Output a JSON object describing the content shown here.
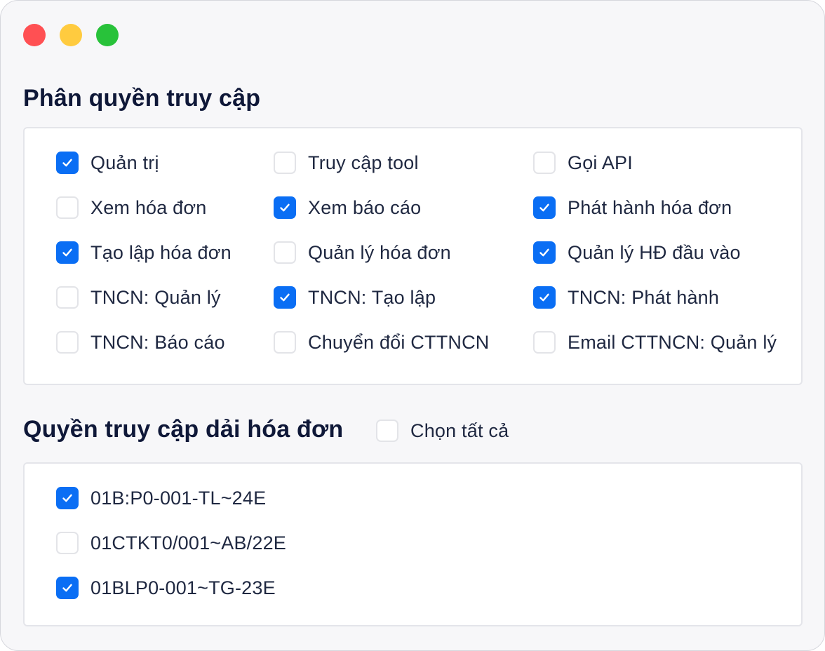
{
  "window": {
    "controls": [
      "close",
      "minimize",
      "maximize"
    ],
    "colors": {
      "close": "#ff5053",
      "minimize": "#ffcb3f",
      "maximize": "#28c23a"
    }
  },
  "access": {
    "title": "Phân quyền truy cập",
    "items": [
      {
        "label": "Quản trị",
        "checked": true
      },
      {
        "label": "Truy cập tool",
        "checked": false
      },
      {
        "label": "Gọi API",
        "checked": false
      },
      {
        "label": "Xem hóa đơn",
        "checked": false
      },
      {
        "label": "Xem báo cáo",
        "checked": true
      },
      {
        "label": "Phát hành hóa đơn",
        "checked": true
      },
      {
        "label": "Tạo lập hóa đơn",
        "checked": true
      },
      {
        "label": "Quản lý hóa đơn",
        "checked": false
      },
      {
        "label": "Quản lý HĐ đầu vào",
        "checked": true
      },
      {
        "label": "TNCN: Quản lý",
        "checked": false
      },
      {
        "label": "TNCN: Tạo lập",
        "checked": true
      },
      {
        "label": "TNCN: Phát hành",
        "checked": true
      },
      {
        "label": "TNCN: Báo cáo",
        "checked": false
      },
      {
        "label": "Chuyển đổi CTTNCN",
        "checked": false
      },
      {
        "label": "Email CTTNCN: Quản lý",
        "checked": false
      }
    ]
  },
  "ranges": {
    "title": "Quyền truy cập dải hóa đơn",
    "select_all": {
      "label": "Chọn tất cả",
      "checked": false
    },
    "items": [
      {
        "label": "01B:P0-001-TL~24E",
        "checked": true
      },
      {
        "label": "01CTKT0/001~AB/22E",
        "checked": false
      },
      {
        "label": "01BLP0-001~TG-23E",
        "checked": true
      }
    ]
  },
  "colors": {
    "accent": "#0a6ef4",
    "heading": "#0f1838",
    "text": "#1f2841"
  }
}
